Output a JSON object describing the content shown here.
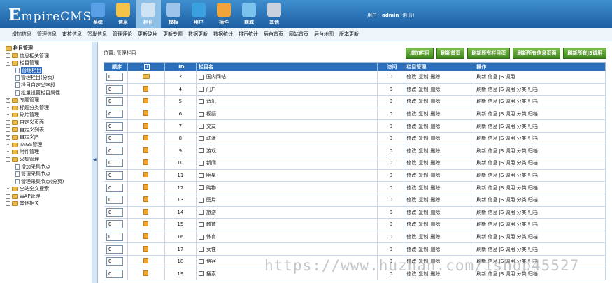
{
  "app": {
    "logo": "EmpireCMS"
  },
  "nav": [
    {
      "label": "系统",
      "icon": "globe-icon"
    },
    {
      "label": "信息",
      "icon": "edit-icon"
    },
    {
      "label": "栏目",
      "icon": "folder-icon",
      "active": true
    },
    {
      "label": "模板",
      "icon": "template-icon"
    },
    {
      "label": "用户",
      "icon": "user-icon"
    },
    {
      "label": "插件",
      "icon": "plugin-icon"
    },
    {
      "label": "商城",
      "icon": "shop-icon"
    },
    {
      "label": "其他",
      "icon": "gear-icon"
    }
  ],
  "user": {
    "prefix": "用户：",
    "name": "admin",
    "logout": "[退出]"
  },
  "submenu": [
    "增加信息",
    "管理信息",
    "审核信息",
    "签发信息",
    "管理评论",
    "更新碎片",
    "更新专题",
    "数据更新",
    "数据统计",
    "排行统计",
    "后台首页",
    "网站首页",
    "后台地图",
    "版本更新"
  ],
  "sidebar": {
    "title": "栏目管理",
    "items": [
      {
        "label": "信息相关管理",
        "level": 0,
        "type": "folder"
      },
      {
        "label": "栏目管理",
        "level": 0,
        "type": "folder"
      },
      {
        "label": "管理栏目",
        "level": 1,
        "type": "page",
        "selected": true
      },
      {
        "label": "管理栏目(分页)",
        "level": 1,
        "type": "page"
      },
      {
        "label": "栏目自定义字段",
        "level": 1,
        "type": "page"
      },
      {
        "label": "批量设置栏目属性",
        "level": 1,
        "type": "page"
      },
      {
        "label": "专题管理",
        "level": 0,
        "type": "folder"
      },
      {
        "label": "标题分类管理",
        "level": 0,
        "type": "folder"
      },
      {
        "label": "碎片管理",
        "level": 0,
        "type": "folder"
      },
      {
        "label": "自定义页面",
        "level": 0,
        "type": "folder"
      },
      {
        "label": "自定义列表",
        "level": 0,
        "type": "folder"
      },
      {
        "label": "自定义JS",
        "level": 0,
        "type": "folder"
      },
      {
        "label": "TAGS管理",
        "level": 0,
        "type": "folder"
      },
      {
        "label": "附件管理",
        "level": 0,
        "type": "folder"
      },
      {
        "label": "采集管理",
        "level": 0,
        "type": "folder"
      },
      {
        "label": "增加采集节点",
        "level": 1,
        "type": "page"
      },
      {
        "label": "管理采集节点",
        "level": 1,
        "type": "page"
      },
      {
        "label": "管理采集节点(分页)",
        "level": 1,
        "type": "page"
      },
      {
        "label": "全站全文搜索",
        "level": 0,
        "type": "folder"
      },
      {
        "label": "WAP管理",
        "level": 0,
        "type": "folder"
      },
      {
        "label": "其他相关",
        "level": 0,
        "type": "folder"
      }
    ]
  },
  "main": {
    "position": "位置: 管理栏目",
    "buttons": [
      "增加栏目",
      "刷新首页",
      "刷新所有栏目页",
      "刷新所有信息页面",
      "刷新所有JS调用"
    ],
    "columns": [
      "顺序",
      "+",
      "ID",
      "栏目名",
      "访问",
      "栏目管理",
      "操作"
    ],
    "manage_links": [
      "修改",
      "复制",
      "删除"
    ],
    "rows": [
      {
        "order": "0",
        "id": "2",
        "name": "国内网站",
        "visits": "0",
        "root": true
      },
      {
        "order": "0",
        "id": "4",
        "name": "门户",
        "visits": "0"
      },
      {
        "order": "0",
        "id": "5",
        "name": "音乐",
        "visits": "0"
      },
      {
        "order": "0",
        "id": "6",
        "name": "视频",
        "visits": "0"
      },
      {
        "order": "0",
        "id": "7",
        "name": "交友",
        "visits": "0"
      },
      {
        "order": "0",
        "id": "8",
        "name": "动漫",
        "visits": "0"
      },
      {
        "order": "0",
        "id": "9",
        "name": "游戏",
        "visits": "0"
      },
      {
        "order": "0",
        "id": "10",
        "name": "新闻",
        "visits": "0"
      },
      {
        "order": "0",
        "id": "11",
        "name": "明星",
        "visits": "0"
      },
      {
        "order": "0",
        "id": "12",
        "name": "购物",
        "visits": "0"
      },
      {
        "order": "0",
        "id": "13",
        "name": "图片",
        "visits": "0"
      },
      {
        "order": "0",
        "id": "14",
        "name": "旅游",
        "visits": "0"
      },
      {
        "order": "0",
        "id": "15",
        "name": "教育",
        "visits": "0"
      },
      {
        "order": "0",
        "id": "16",
        "name": "体育",
        "visits": "0"
      },
      {
        "order": "0",
        "id": "17",
        "name": "女性",
        "visits": "0"
      },
      {
        "order": "0",
        "id": "18",
        "name": "博客",
        "visits": "0"
      },
      {
        "order": "0",
        "id": "19",
        "name": "搜索",
        "visits": "0"
      }
    ],
    "ops_root": "刷新 信息 JS 调用",
    "ops_child": "刷新 信息 JS 调用 分类 归档"
  },
  "watermark": "https://www.huzhan.com/ishop45527"
}
